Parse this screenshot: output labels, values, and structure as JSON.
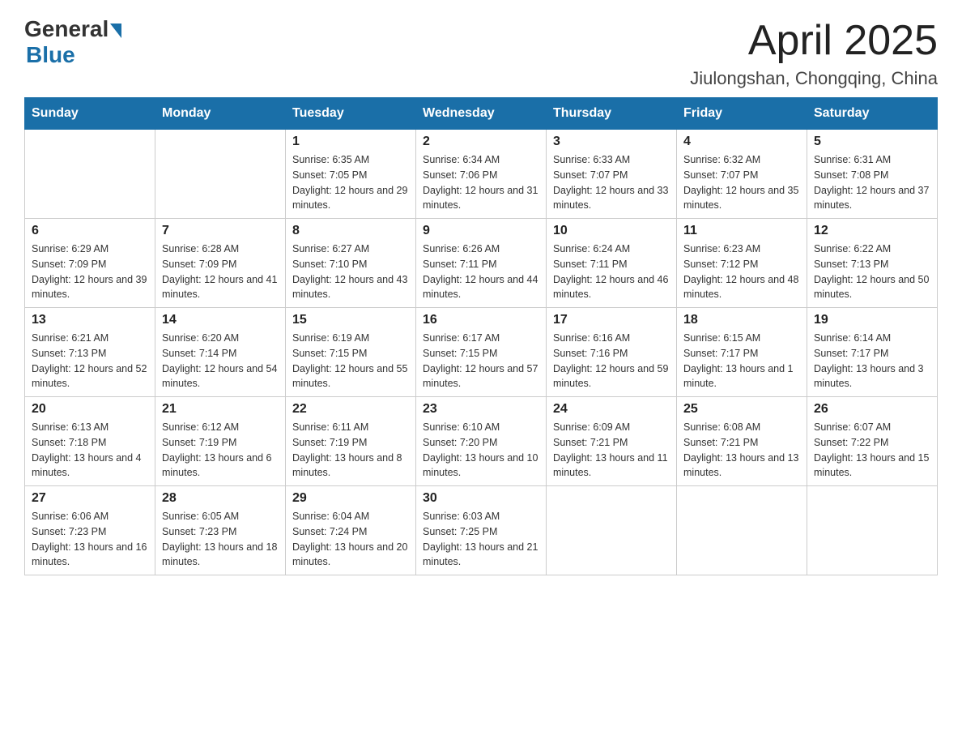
{
  "header": {
    "logo_general": "General",
    "logo_blue": "Blue",
    "title": "April 2025",
    "subtitle": "Jiulongshan, Chongqing, China"
  },
  "calendar": {
    "days_of_week": [
      "Sunday",
      "Monday",
      "Tuesday",
      "Wednesday",
      "Thursday",
      "Friday",
      "Saturday"
    ],
    "weeks": [
      [
        {
          "day": "",
          "sunrise": "",
          "sunset": "",
          "daylight": ""
        },
        {
          "day": "",
          "sunrise": "",
          "sunset": "",
          "daylight": ""
        },
        {
          "day": "1",
          "sunrise": "Sunrise: 6:35 AM",
          "sunset": "Sunset: 7:05 PM",
          "daylight": "Daylight: 12 hours and 29 minutes."
        },
        {
          "day": "2",
          "sunrise": "Sunrise: 6:34 AM",
          "sunset": "Sunset: 7:06 PM",
          "daylight": "Daylight: 12 hours and 31 minutes."
        },
        {
          "day": "3",
          "sunrise": "Sunrise: 6:33 AM",
          "sunset": "Sunset: 7:07 PM",
          "daylight": "Daylight: 12 hours and 33 minutes."
        },
        {
          "day": "4",
          "sunrise": "Sunrise: 6:32 AM",
          "sunset": "Sunset: 7:07 PM",
          "daylight": "Daylight: 12 hours and 35 minutes."
        },
        {
          "day": "5",
          "sunrise": "Sunrise: 6:31 AM",
          "sunset": "Sunset: 7:08 PM",
          "daylight": "Daylight: 12 hours and 37 minutes."
        }
      ],
      [
        {
          "day": "6",
          "sunrise": "Sunrise: 6:29 AM",
          "sunset": "Sunset: 7:09 PM",
          "daylight": "Daylight: 12 hours and 39 minutes."
        },
        {
          "day": "7",
          "sunrise": "Sunrise: 6:28 AM",
          "sunset": "Sunset: 7:09 PM",
          "daylight": "Daylight: 12 hours and 41 minutes."
        },
        {
          "day": "8",
          "sunrise": "Sunrise: 6:27 AM",
          "sunset": "Sunset: 7:10 PM",
          "daylight": "Daylight: 12 hours and 43 minutes."
        },
        {
          "day": "9",
          "sunrise": "Sunrise: 6:26 AM",
          "sunset": "Sunset: 7:11 PM",
          "daylight": "Daylight: 12 hours and 44 minutes."
        },
        {
          "day": "10",
          "sunrise": "Sunrise: 6:24 AM",
          "sunset": "Sunset: 7:11 PM",
          "daylight": "Daylight: 12 hours and 46 minutes."
        },
        {
          "day": "11",
          "sunrise": "Sunrise: 6:23 AM",
          "sunset": "Sunset: 7:12 PM",
          "daylight": "Daylight: 12 hours and 48 minutes."
        },
        {
          "day": "12",
          "sunrise": "Sunrise: 6:22 AM",
          "sunset": "Sunset: 7:13 PM",
          "daylight": "Daylight: 12 hours and 50 minutes."
        }
      ],
      [
        {
          "day": "13",
          "sunrise": "Sunrise: 6:21 AM",
          "sunset": "Sunset: 7:13 PM",
          "daylight": "Daylight: 12 hours and 52 minutes."
        },
        {
          "day": "14",
          "sunrise": "Sunrise: 6:20 AM",
          "sunset": "Sunset: 7:14 PM",
          "daylight": "Daylight: 12 hours and 54 minutes."
        },
        {
          "day": "15",
          "sunrise": "Sunrise: 6:19 AM",
          "sunset": "Sunset: 7:15 PM",
          "daylight": "Daylight: 12 hours and 55 minutes."
        },
        {
          "day": "16",
          "sunrise": "Sunrise: 6:17 AM",
          "sunset": "Sunset: 7:15 PM",
          "daylight": "Daylight: 12 hours and 57 minutes."
        },
        {
          "day": "17",
          "sunrise": "Sunrise: 6:16 AM",
          "sunset": "Sunset: 7:16 PM",
          "daylight": "Daylight: 12 hours and 59 minutes."
        },
        {
          "day": "18",
          "sunrise": "Sunrise: 6:15 AM",
          "sunset": "Sunset: 7:17 PM",
          "daylight": "Daylight: 13 hours and 1 minute."
        },
        {
          "day": "19",
          "sunrise": "Sunrise: 6:14 AM",
          "sunset": "Sunset: 7:17 PM",
          "daylight": "Daylight: 13 hours and 3 minutes."
        }
      ],
      [
        {
          "day": "20",
          "sunrise": "Sunrise: 6:13 AM",
          "sunset": "Sunset: 7:18 PM",
          "daylight": "Daylight: 13 hours and 4 minutes."
        },
        {
          "day": "21",
          "sunrise": "Sunrise: 6:12 AM",
          "sunset": "Sunset: 7:19 PM",
          "daylight": "Daylight: 13 hours and 6 minutes."
        },
        {
          "day": "22",
          "sunrise": "Sunrise: 6:11 AM",
          "sunset": "Sunset: 7:19 PM",
          "daylight": "Daylight: 13 hours and 8 minutes."
        },
        {
          "day": "23",
          "sunrise": "Sunrise: 6:10 AM",
          "sunset": "Sunset: 7:20 PM",
          "daylight": "Daylight: 13 hours and 10 minutes."
        },
        {
          "day": "24",
          "sunrise": "Sunrise: 6:09 AM",
          "sunset": "Sunset: 7:21 PM",
          "daylight": "Daylight: 13 hours and 11 minutes."
        },
        {
          "day": "25",
          "sunrise": "Sunrise: 6:08 AM",
          "sunset": "Sunset: 7:21 PM",
          "daylight": "Daylight: 13 hours and 13 minutes."
        },
        {
          "day": "26",
          "sunrise": "Sunrise: 6:07 AM",
          "sunset": "Sunset: 7:22 PM",
          "daylight": "Daylight: 13 hours and 15 minutes."
        }
      ],
      [
        {
          "day": "27",
          "sunrise": "Sunrise: 6:06 AM",
          "sunset": "Sunset: 7:23 PM",
          "daylight": "Daylight: 13 hours and 16 minutes."
        },
        {
          "day": "28",
          "sunrise": "Sunrise: 6:05 AM",
          "sunset": "Sunset: 7:23 PM",
          "daylight": "Daylight: 13 hours and 18 minutes."
        },
        {
          "day": "29",
          "sunrise": "Sunrise: 6:04 AM",
          "sunset": "Sunset: 7:24 PM",
          "daylight": "Daylight: 13 hours and 20 minutes."
        },
        {
          "day": "30",
          "sunrise": "Sunrise: 6:03 AM",
          "sunset": "Sunset: 7:25 PM",
          "daylight": "Daylight: 13 hours and 21 minutes."
        },
        {
          "day": "",
          "sunrise": "",
          "sunset": "",
          "daylight": ""
        },
        {
          "day": "",
          "sunrise": "",
          "sunset": "",
          "daylight": ""
        },
        {
          "day": "",
          "sunrise": "",
          "sunset": "",
          "daylight": ""
        }
      ]
    ]
  }
}
